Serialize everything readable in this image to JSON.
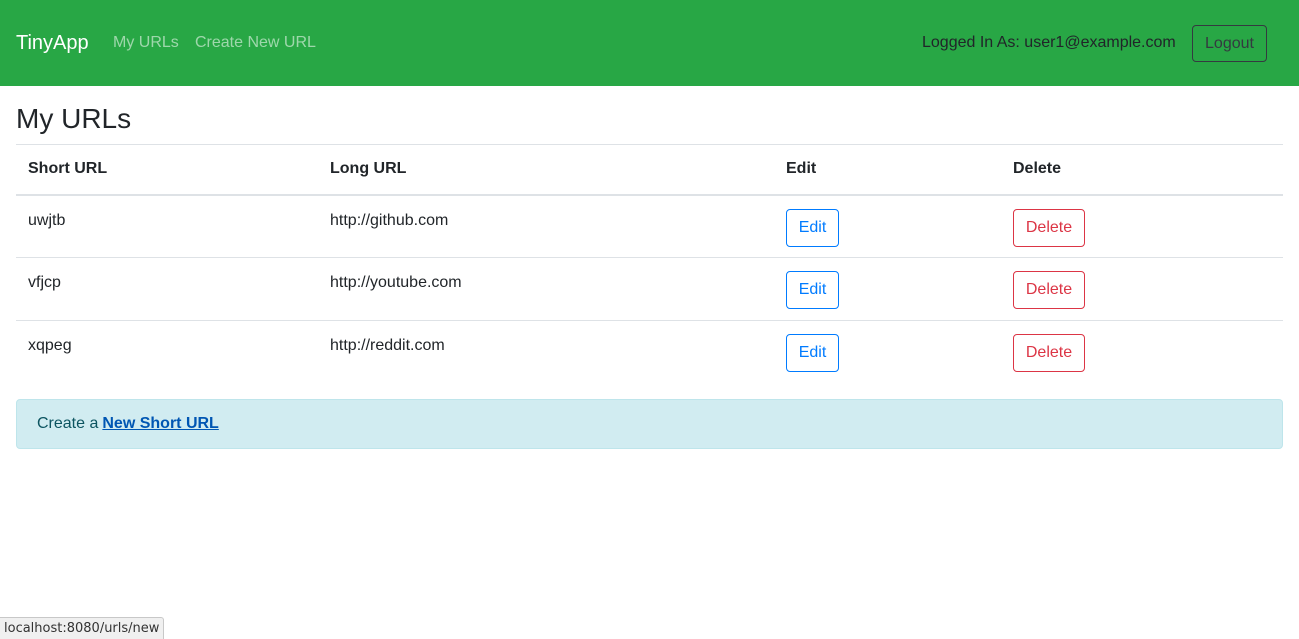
{
  "navbar": {
    "brand": "TinyApp",
    "links": [
      {
        "label": "My URLs"
      },
      {
        "label": "Create New URL"
      }
    ],
    "logged_in_text": "Logged In As: user1@example.com",
    "logout_label": "Logout",
    "color": "#28a745"
  },
  "page": {
    "title": "My URLs"
  },
  "table": {
    "headers": [
      "Short URL",
      "Long URL",
      "Edit",
      "Delete"
    ],
    "rows": [
      {
        "short": "uwjtb",
        "long": "http://github.com",
        "edit": "Edit",
        "delete": "Delete"
      },
      {
        "short": "vfjcp",
        "long": "http://youtube.com",
        "edit": "Edit",
        "delete": "Delete"
      },
      {
        "short": "xqpeg",
        "long": "http://reddit.com",
        "edit": "Edit",
        "delete": "Delete"
      }
    ]
  },
  "alert": {
    "prefix": "Create a",
    "link_label": "New Short URL"
  },
  "status_bar": {
    "url": "localhost:8080/urls/new"
  }
}
